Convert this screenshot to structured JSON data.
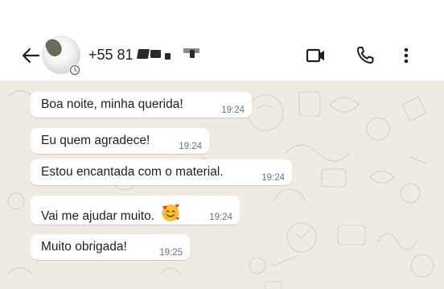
{
  "header": {
    "contact_prefix": "+55 81",
    "contact_redacted": true
  },
  "messages": [
    {
      "text": "Boa noite, minha querida!",
      "time": "19:24"
    },
    {
      "text": "Eu quem agradece!",
      "time": "19:24"
    },
    {
      "text": "Estou encantada com o material.",
      "time": "19:24"
    },
    {
      "text": "Vai me ajudar muito.",
      "time": "19:24",
      "emoji": "smiling-face-with-hearts"
    },
    {
      "text": "Muito obrigada!",
      "time": "19:25"
    }
  ],
  "icons": {
    "back": "arrow-left-icon",
    "video": "video-call-icon",
    "phone": "phone-icon",
    "menu": "more-vert-icon"
  },
  "colors": {
    "chat_background": "#efeae2",
    "bubble": "#ffffff",
    "timestamp": "#667781"
  }
}
